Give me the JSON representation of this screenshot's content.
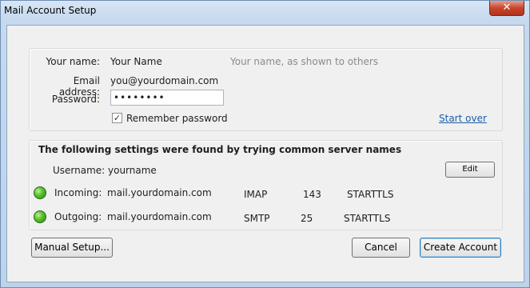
{
  "window": {
    "title": "Mail Account Setup",
    "close_glyph": "✕"
  },
  "identity": {
    "name_label": "Your name:",
    "name_value": "Your Name",
    "name_hint": "Your name, as shown to others",
    "email_label": "Email address:",
    "email_value": "you@yourdomain.com",
    "password_label": "Password:",
    "password_value": "••••••••",
    "remember_label": "Remember password",
    "remember_checked": true,
    "start_over": "Start over"
  },
  "settings": {
    "heading": "The following settings were found by trying common server names",
    "username_label": "Username:",
    "username_value": "yourname",
    "edit_button": "Edit",
    "incoming": {
      "label": "Incoming:",
      "server": "mail.yourdomain.com",
      "protocol": "IMAP",
      "port": "143",
      "security": "STARTTLS",
      "status_color": "#4bb82a"
    },
    "outgoing": {
      "label": "Outgoing:",
      "server": "mail.yourdomain.com",
      "protocol": "SMTP",
      "port": "25",
      "security": "STARTTLS",
      "status_color": "#4bb82a"
    }
  },
  "buttons": {
    "manual_setup": "Manual Setup...",
    "cancel": "Cancel",
    "create_account": "Create Account"
  }
}
